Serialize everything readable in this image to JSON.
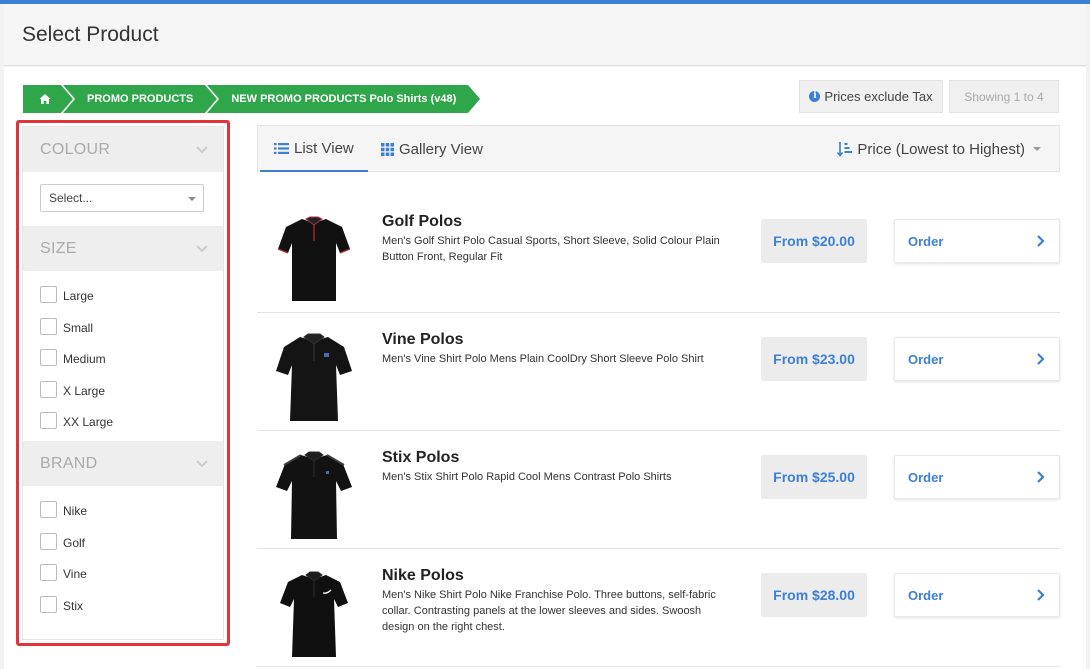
{
  "header": {
    "title": "Select Product"
  },
  "breadcrumb": [
    {
      "label": ""
    },
    {
      "label": "PROMO PRODUCTS"
    },
    {
      "label": "NEW PROMO PRODUCTS Polo Shirts (v48)"
    }
  ],
  "toolbar_top": {
    "tax_label": "Prices exclude Tax",
    "showing_label": "Showing 1 to 4"
  },
  "filters": {
    "colour": {
      "title": "COLOUR",
      "select_value": "Select..."
    },
    "size": {
      "title": "SIZE",
      "options": [
        "Large",
        "Small",
        "Medium",
        "X Large",
        "XX Large"
      ]
    },
    "brand": {
      "title": "BRAND",
      "options": [
        "Nike",
        "Golf",
        "Vine",
        "Stix"
      ]
    }
  },
  "view": {
    "list_label": "List View",
    "gallery_label": "Gallery View",
    "sort_label": "Price (Lowest to Highest)"
  },
  "products": [
    {
      "name": "Golf Polos",
      "desc": "Men's Golf Shirt Polo Casual Sports, Short Sleeve, Solid Colour Plain Button Front, Regular Fit",
      "price": "From $20.00",
      "order": "Order"
    },
    {
      "name": "Vine Polos",
      "desc": "Men's Vine Shirt Polo Mens Plain CoolDry Short Sleeve Polo Shirt",
      "price": "From $23.00",
      "order": "Order"
    },
    {
      "name": "Stix Polos",
      "desc": "Men's Stix Shirt Polo Rapid Cool Mens Contrast Polo Shirts",
      "price": "From $25.00",
      "order": "Order"
    },
    {
      "name": "Nike Polos",
      "desc": "Men's Nike Shirt Polo Nike Franchise Polo. Three buttons, self-fabric collar. Contrasting panels at the lower sleeves and sides. Swoosh design on the right chest.",
      "price": "From $28.00",
      "order": "Order"
    }
  ],
  "colors": {
    "accent": "#3c7fd6",
    "breadcrumb": "#2fa64a",
    "highlight": "#e0343a"
  }
}
